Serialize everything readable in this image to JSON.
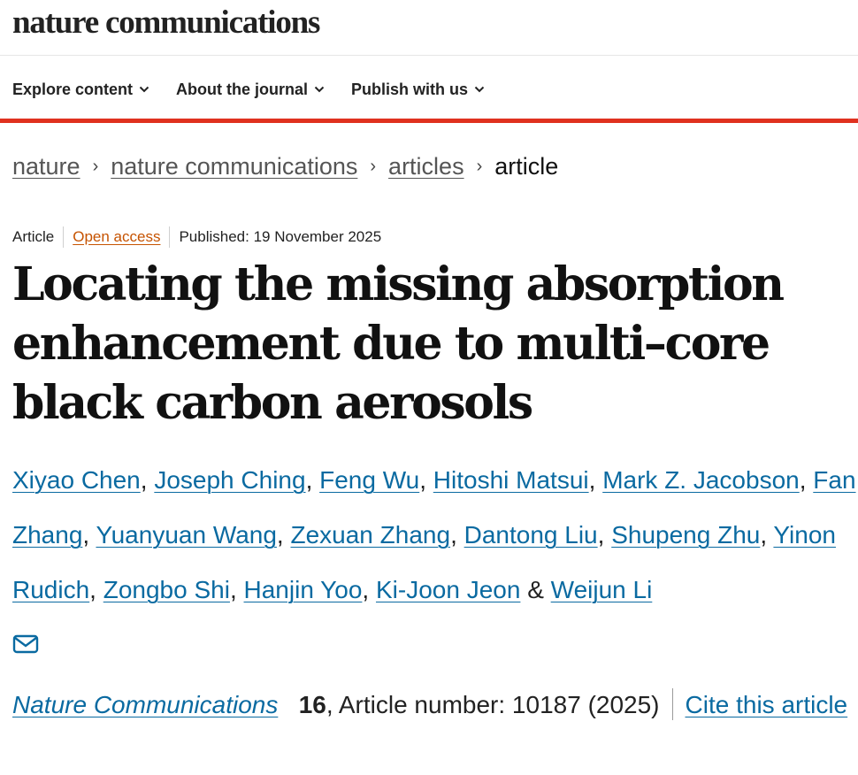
{
  "header": {
    "brand": "nature communications"
  },
  "nav": {
    "items": [
      {
        "label": "Explore content"
      },
      {
        "label": "About the journal"
      },
      {
        "label": "Publish with us"
      }
    ]
  },
  "breadcrumb": {
    "items": [
      "nature",
      "nature communications",
      "articles"
    ],
    "separator": "›",
    "current": "article"
  },
  "article": {
    "type": "Article",
    "access": "Open access",
    "published": "Published: 19 November 2025",
    "title": "Locating the missing absorption enhancement due to multi–core black carbon aerosols",
    "authors": [
      "Xiyao Chen",
      "Joseph Ching",
      "Feng Wu",
      "Hitoshi Matsui",
      "Mark Z. Jacobson",
      "Fan Zhang",
      "Yuanyuan Wang",
      "Zexuan Zhang",
      "Dantong Liu",
      "Shupeng Zhu",
      "Yinon Rudich",
      "Zongbo Shi",
      "Hanjin Yoo",
      "Ki-Joon Jeon",
      "Weijun Li"
    ],
    "author_separator": ", ",
    "author_last_separator": " & ",
    "contact_icon": "mail-icon",
    "citation": {
      "journal": "Nature Communications",
      "volume": "16",
      "article_number": ", Article number: 10187 (2025)",
      "cite_link": "Cite this article"
    }
  },
  "colors": {
    "accent_red": "#e0311f",
    "link_blue": "#0a6aa1",
    "open_access_orange": "#c65301"
  }
}
